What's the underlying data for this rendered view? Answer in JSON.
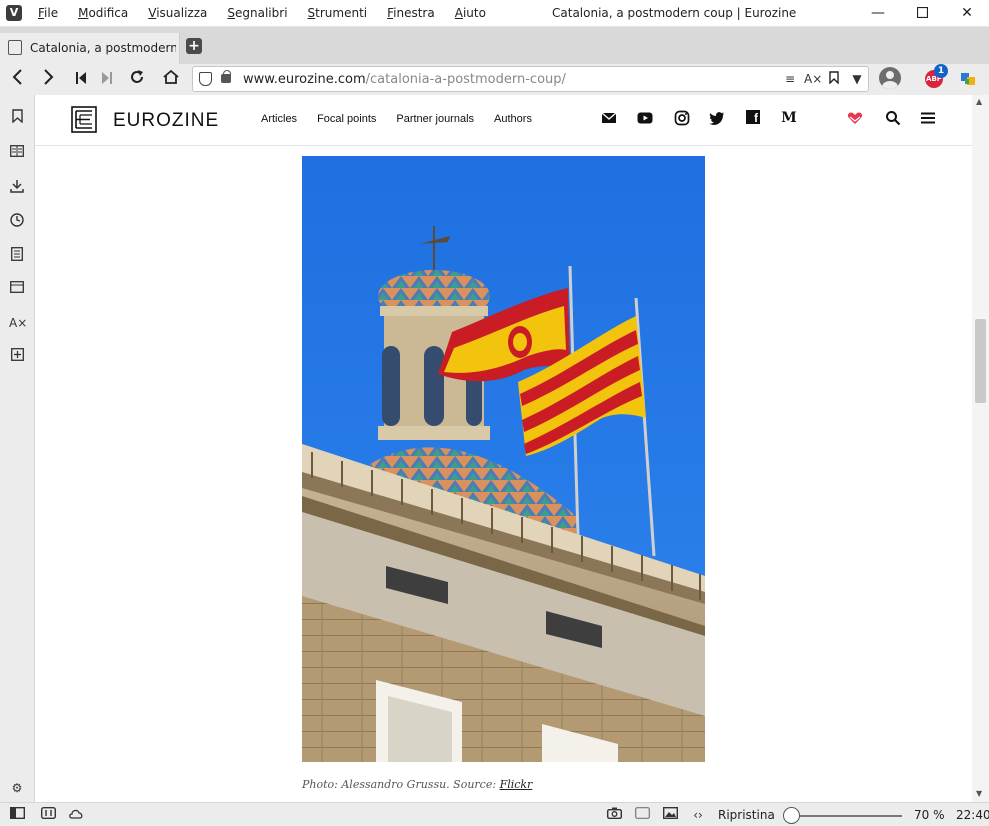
{
  "window": {
    "menus": [
      "File",
      "Modifica",
      "Visualizza",
      "Segnalibri",
      "Strumenti",
      "Finestra",
      "Aiuto"
    ],
    "title": "Catalonia, a postmodern coup | Eurozine"
  },
  "tab": {
    "label": "Catalonia, a postmodern coup | Eurozine"
  },
  "address": {
    "host": "www.eurozine.com",
    "path": "/catalonia-a-postmodern-coup/"
  },
  "extensions": {
    "adblock_count": "1",
    "adblock_label": "ABP"
  },
  "site": {
    "logo_text": "EUROZINE",
    "nav": [
      "Articles",
      "Focal points",
      "Partner journals",
      "Authors"
    ],
    "social_icons": [
      "mail-icon",
      "youtube-icon",
      "instagram-icon",
      "twitter-icon",
      "facebook-icon",
      "medium-icon"
    ],
    "medium_glyph": "M",
    "facebook_glyph": "f"
  },
  "article": {
    "caption_prefix": "Photo: Alessandro Grussu. Source: ",
    "caption_link": "Flickr"
  },
  "status": {
    "reset_label": "Ripristina",
    "zoom_label": "70 %",
    "zoom_percent": 70,
    "clock": "22:40"
  }
}
